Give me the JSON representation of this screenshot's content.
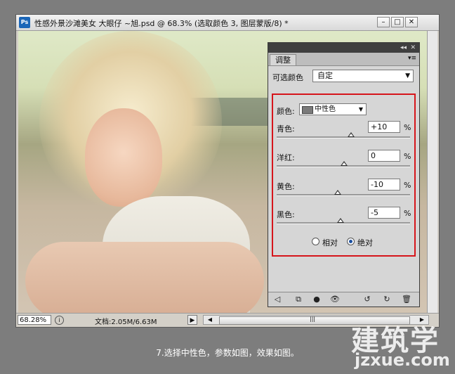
{
  "window": {
    "app_icon": "Ps",
    "title": "性感外景沙滩美女  大眼仔 ~旭.psd @ 68.3% (选取颜色 3, 图层蒙版/8) *",
    "minimize": "–",
    "restore": "□",
    "close": "✕"
  },
  "status": {
    "zoom": "68.28%",
    "doc_info": "文档:2.05M/6.63M",
    "arrow": "▶",
    "left_arrow": "◀",
    "right_arrow": "▶",
    "grip": "|||"
  },
  "panel": {
    "collapse": "◂◂",
    "close": "✕",
    "tab": "调整",
    "menu_icon": "▾≡",
    "preset_label": "可选颜色",
    "preset_value": "自定",
    "color_label": "颜色:",
    "color_value": "中性色",
    "sliders": [
      {
        "label": "青色:",
        "value": "+10",
        "unit": "%",
        "level": 10
      },
      {
        "label": "洋红:",
        "value": "0",
        "unit": "%",
        "level": 0
      },
      {
        "label": "黄色:",
        "value": "-10",
        "unit": "%",
        "level": -10
      },
      {
        "label": "黑色:",
        "value": "-5",
        "unit": "%",
        "level": -5
      }
    ],
    "method": {
      "relative": "相对",
      "absolute": "绝对",
      "selected": "absolute"
    },
    "bottom_icons": [
      "back-icon",
      "clip-icon",
      "mask-icon",
      "eye-icon",
      "reset-icon",
      "refresh-icon",
      "trash-icon"
    ],
    "bottom_glyphs": [
      "◁",
      "⧉",
      "●",
      "👁",
      "↺",
      "↻",
      "🗑"
    ]
  },
  "caption": "7.选择中性色，参数如图，效果如图。",
  "watermark": {
    "brand": "建筑学",
    "url": "jzxue.com"
  },
  "colors": {
    "highlight_box": "#d6151b",
    "background": "#7d7d7d"
  }
}
